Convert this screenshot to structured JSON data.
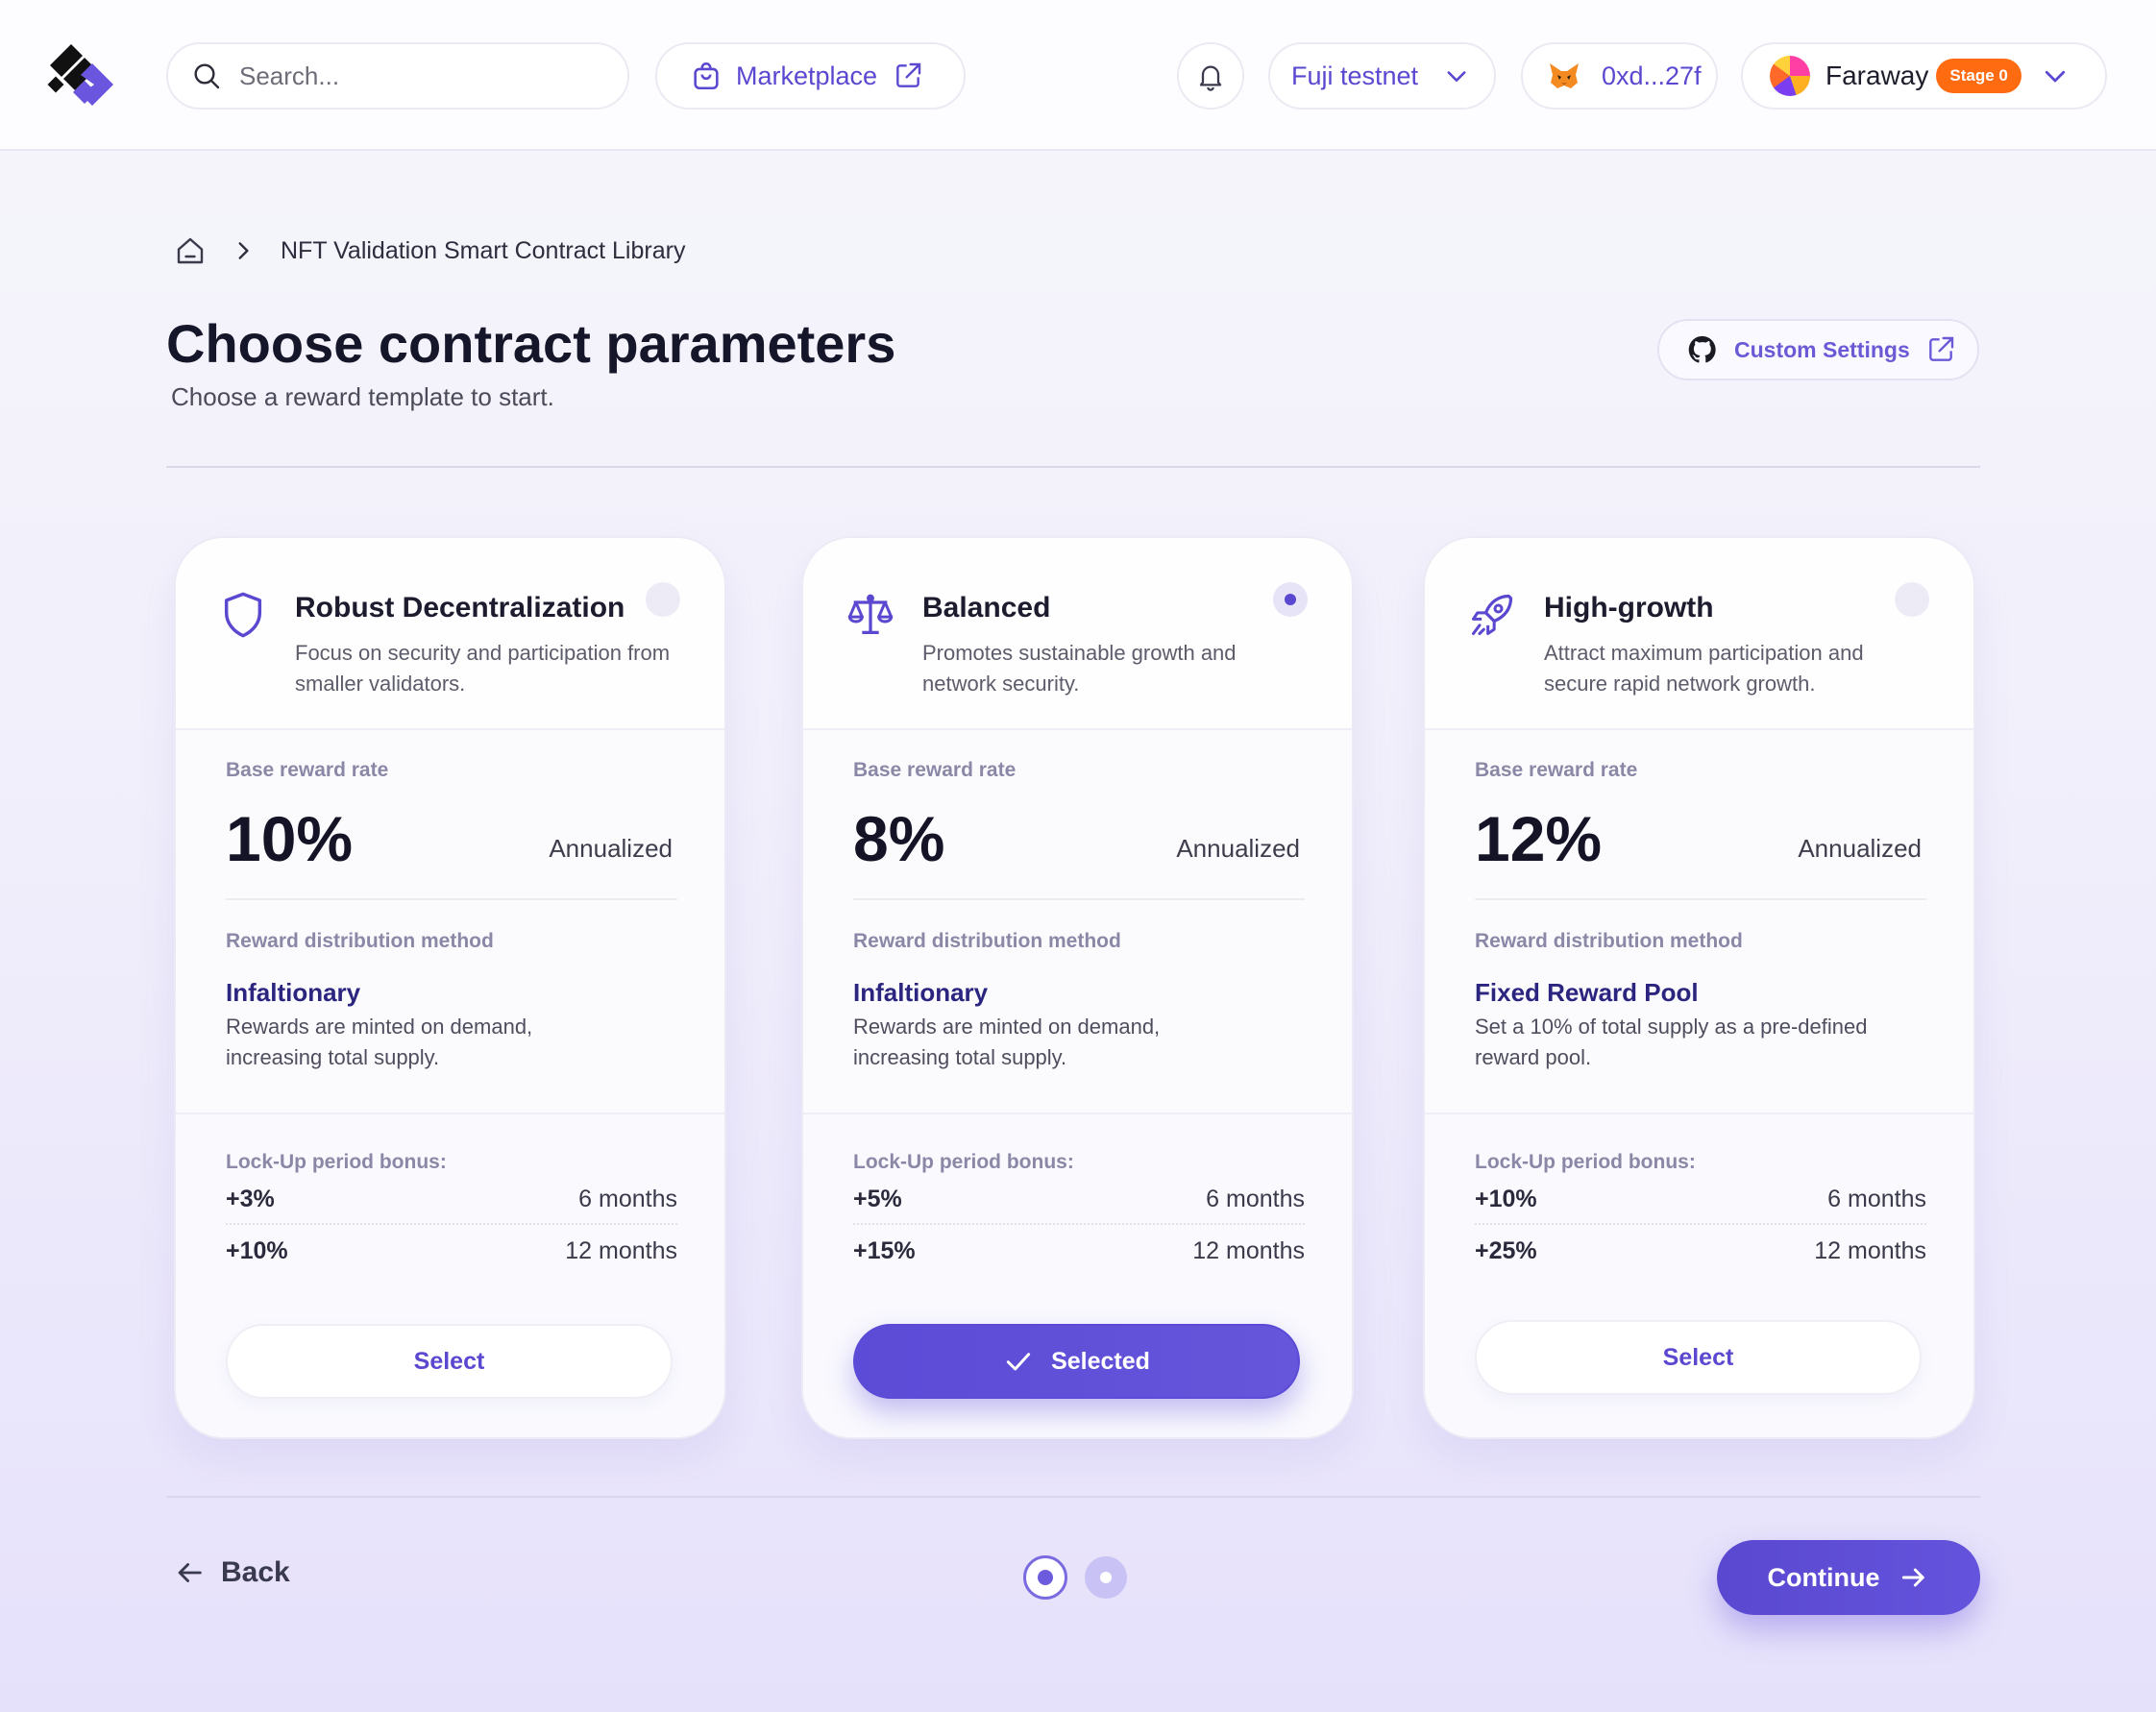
{
  "header": {
    "search_placeholder": "Search...",
    "marketplace_label": "Marketplace",
    "network_label": "Fuji testnet",
    "wallet_label": "0xd...27f",
    "account_name": "Faraway",
    "stage_badge": "Stage 0"
  },
  "breadcrumb": {
    "current": "NFT Validation Smart Contract Library"
  },
  "page": {
    "title": "Choose contract parameters",
    "subtitle": "Choose a reward template to start.",
    "custom_settings_label": "Custom Settings"
  },
  "cards": [
    {
      "icon": "shield-icon",
      "name": "Robust Decentralization",
      "description": "Focus on security and participation from smaller validators.",
      "selected": false,
      "base_rate_label": "Base reward rate",
      "base_rate": "10%",
      "rate_unit": "Annualized",
      "method_label": "Reward distribution method",
      "method": "Infaltionary",
      "method_desc": "Rewards are minted on demand, increasing total supply.",
      "lockup_label": "Lock-Up period bonus:",
      "bonuses": [
        {
          "bonus": "+3%",
          "period": "6 months"
        },
        {
          "bonus": "+10%",
          "period": "12 months"
        }
      ],
      "button_label": "Select"
    },
    {
      "icon": "scale-icon",
      "name": "Balanced",
      "description": "Promotes sustainable growth and network security.",
      "selected": true,
      "base_rate_label": "Base reward rate",
      "base_rate": "8%",
      "rate_unit": "Annualized",
      "method_label": "Reward distribution method",
      "method": "Infaltionary",
      "method_desc": "Rewards are minted on demand, increasing total supply.",
      "lockup_label": "Lock-Up period bonus:",
      "bonuses": [
        {
          "bonus": "+5%",
          "period": "6 months"
        },
        {
          "bonus": "+15%",
          "period": "12 months"
        }
      ],
      "button_label": "Selected"
    },
    {
      "icon": "rocket-icon",
      "name": "High-growth",
      "description": "Attract maximum participation and secure rapid network growth.",
      "selected": false,
      "base_rate_label": "Base reward rate",
      "base_rate": "12%",
      "rate_unit": "Annualized",
      "method_label": "Reward distribution method",
      "method": "Fixed Reward Pool",
      "method_desc": "Set a 10% of total supply as a pre-defined reward pool.",
      "lockup_label": "Lock-Up period bonus:",
      "bonuses": [
        {
          "bonus": "+10%",
          "period": "6 months"
        },
        {
          "bonus": "+25%",
          "period": "12 months"
        }
      ],
      "button_label": "Select"
    }
  ],
  "footer": {
    "back_label": "Back",
    "continue_label": "Continue",
    "current_step": 1,
    "total_steps": 2
  },
  "colors": {
    "accent": "#5a48d0",
    "badge": "#ff6b10"
  }
}
